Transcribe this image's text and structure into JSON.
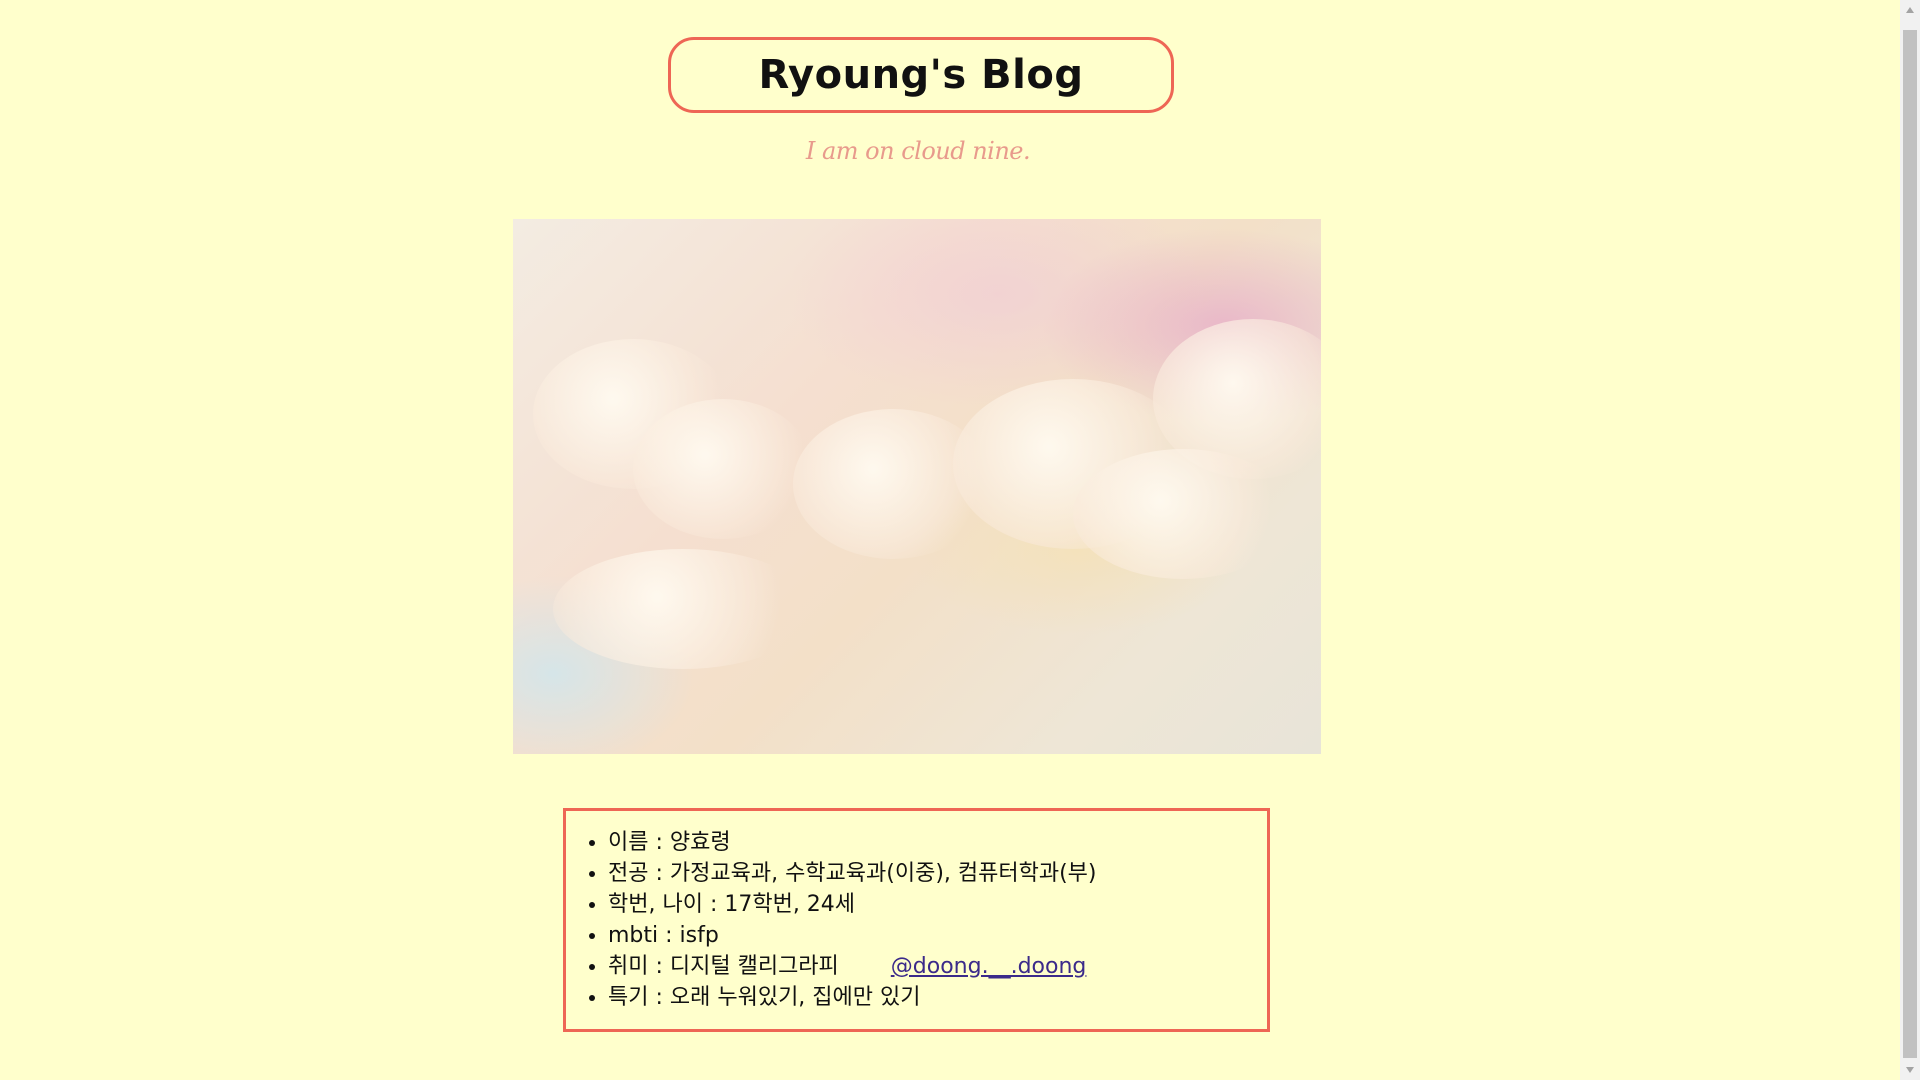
{
  "header": {
    "title": "Ryoung's Blog",
    "subtitle": "I am on cloud nine."
  },
  "hero": {
    "image_description_icon": "cloud-sky-image"
  },
  "profile": {
    "items": [
      {
        "text": "이름 : 양효령"
      },
      {
        "text": "전공 : 가정교육과, 수학교육과(이중), 컴퓨터학과(부)"
      },
      {
        "text": "학번, 나이 : 17학번, 24세"
      },
      {
        "text": "mbti : isfp"
      },
      {
        "text": "취미 : 디지털 캘리그라피",
        "link": "@doong.__.doong"
      },
      {
        "text": "특기 : 오래 누워있기, 집에만 있기"
      }
    ]
  },
  "colors": {
    "background": "#ffffcc",
    "accent_border": "#ee6655",
    "subtitle": "#e89a8c",
    "link": "#3b2a8a"
  }
}
